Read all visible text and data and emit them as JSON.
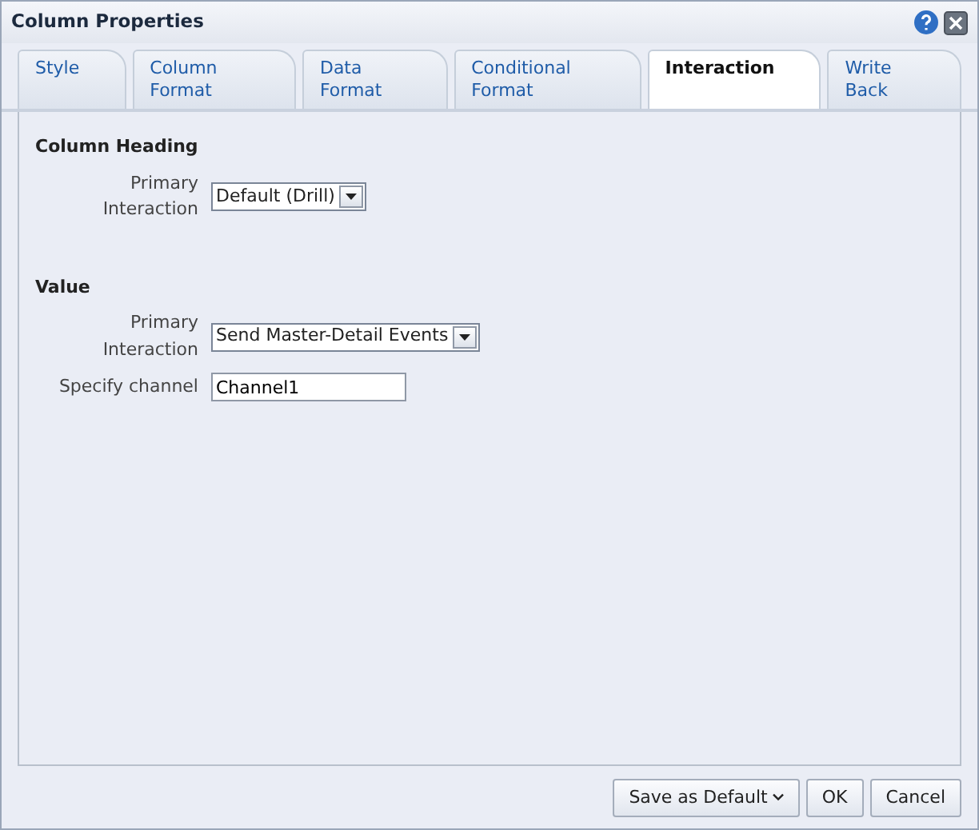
{
  "window": {
    "title": "Column Properties"
  },
  "tabs": [
    {
      "label": "Style",
      "selected": false
    },
    {
      "label": "Column Format",
      "selected": false
    },
    {
      "label": "Data Format",
      "selected": false
    },
    {
      "label": "Conditional Format",
      "selected": false
    },
    {
      "label": "Interaction",
      "selected": true
    },
    {
      "label": "Write Back",
      "selected": false
    }
  ],
  "sections": [
    {
      "heading": "Column Heading",
      "rows": [
        {
          "kind": "select",
          "label": "Primary Interaction",
          "value": "Default (Drill)"
        }
      ]
    },
    {
      "heading": "Value",
      "rows": [
        {
          "kind": "select",
          "label": "Primary Interaction",
          "value": "Send Master-Detail Events"
        },
        {
          "kind": "text",
          "label": "Specify channel",
          "value": "Channel1"
        }
      ]
    }
  ],
  "buttons": [
    {
      "label": "Save as Default",
      "kind": "menu"
    },
    {
      "label": "OK",
      "kind": "plain"
    },
    {
      "label": "Cancel",
      "kind": "plain"
    }
  ]
}
